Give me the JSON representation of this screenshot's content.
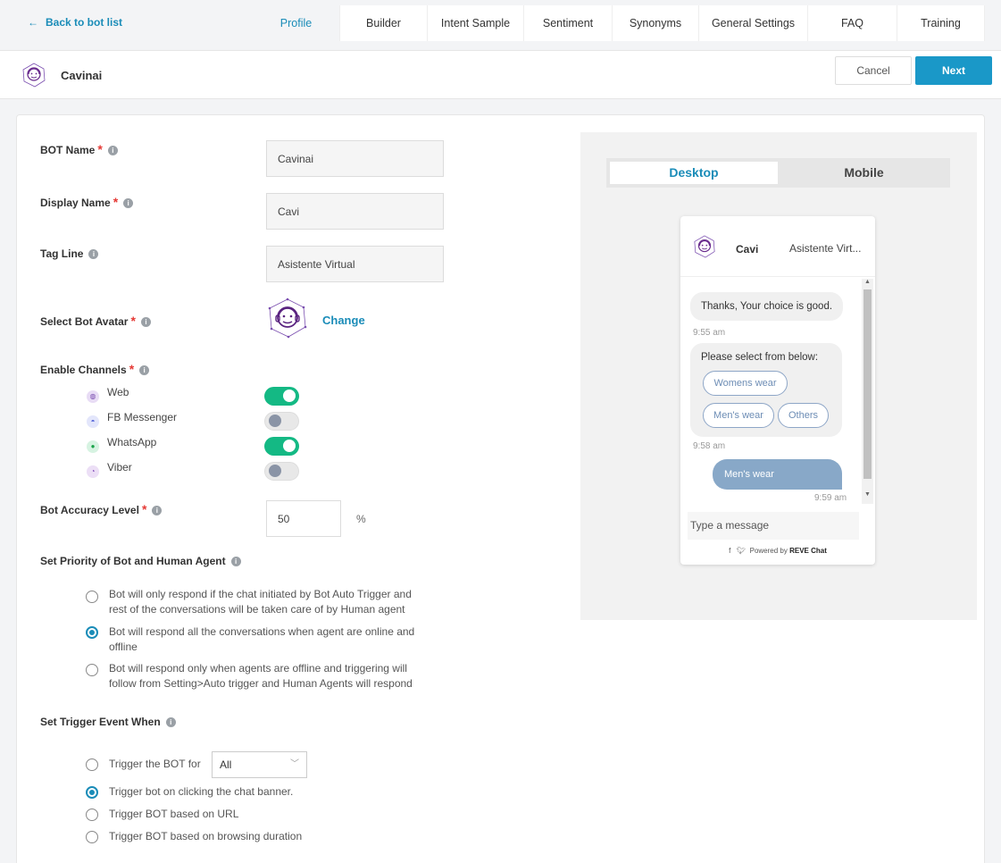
{
  "nav": {
    "back_label": "Back to bot list",
    "tabs": [
      {
        "label": "Profile",
        "active": true
      },
      {
        "label": "Builder"
      },
      {
        "label": "Intent Sample"
      },
      {
        "label": "Sentiment"
      },
      {
        "label": "Synonyms"
      },
      {
        "label": "General Settings"
      },
      {
        "label": "FAQ"
      },
      {
        "label": "Training"
      }
    ]
  },
  "header": {
    "bot_name": "Cavinai",
    "cancel_label": "Cancel",
    "next_label": "Next"
  },
  "form": {
    "bot_name_label": "BOT Name",
    "bot_name_value": "Cavinai",
    "display_name_label": "Display Name",
    "display_name_value": "Cavi",
    "tag_line_label": "Tag Line",
    "tag_line_value": "Asistente Virtual",
    "avatar_label": "Select Bot Avatar",
    "change_label": "Change",
    "channels_label": "Enable Channels",
    "channels": [
      {
        "name": "Web",
        "enabled": true
      },
      {
        "name": "FB Messenger",
        "enabled": false
      },
      {
        "name": "WhatsApp",
        "enabled": true
      },
      {
        "name": "Viber",
        "enabled": false
      }
    ],
    "accuracy_label": "Bot Accuracy Level",
    "accuracy_value": "50",
    "accuracy_unit": "%",
    "priority_label": "Set Priority of Bot and Human Agent",
    "priority_options": [
      {
        "line1": "Bot will only respond if the chat initiated by Bot Auto Trigger and",
        "line2": "rest of the conversations will be taken care of by Human agent",
        "selected": false
      },
      {
        "line1": "Bot will respond all the conversations when agent are online and",
        "line2": "offline",
        "selected": true
      },
      {
        "line1": "Bot will respond only when agents are offline and triggering will",
        "line2": "follow from Setting>Auto trigger and Human Agents will respond",
        "selected": false
      }
    ],
    "trigger_label": "Set Trigger Event When",
    "trigger_options": [
      {
        "label": "Trigger the BOT for",
        "selected": false
      },
      {
        "label": "Trigger bot on clicking the chat banner.",
        "selected": true
      },
      {
        "label": "Trigger BOT based on URL",
        "selected": false
      },
      {
        "label": "Trigger BOT based on browsing duration",
        "selected": false
      }
    ],
    "trigger_select_value": "All"
  },
  "preview": {
    "tab_desktop": "Desktop",
    "tab_mobile": "Mobile",
    "widget": {
      "name": "Cavi",
      "tagline": "Asistente Virt...",
      "msg1": "Thanks, Your choice is good.",
      "time1": "9:55 am",
      "msg2": "Please select from below:",
      "chips": [
        "Womens wear",
        "Men's wear",
        "Others"
      ],
      "time2": "9:58 am",
      "reply": "Men's wear",
      "time3": "9:59 am",
      "input_placeholder": "Type a message",
      "powered_prefix": "Powered by",
      "powered_brand": "REVE Chat"
    }
  },
  "colors": {
    "accent": "#1a98c8",
    "toggle_on": "#14b984",
    "required": "#e53935"
  }
}
